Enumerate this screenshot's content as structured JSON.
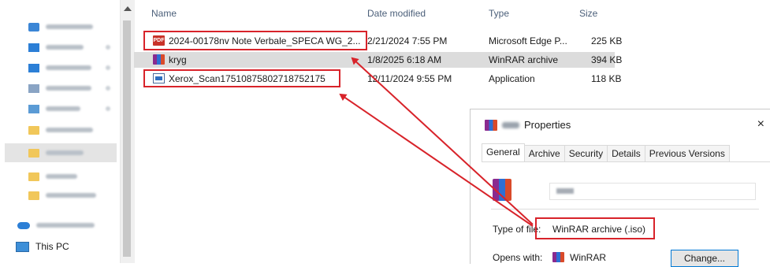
{
  "nav": {
    "this_pc": "This PC"
  },
  "columns": {
    "name": "Name",
    "date": "Date modified",
    "type": "Type",
    "size": "Size"
  },
  "files": [
    {
      "name": "2024-00178nv Note Verbale_SPECA WG_2...",
      "date": "2/21/2024 7:55 PM",
      "type": "Microsoft Edge P...",
      "size": "225 KB",
      "icon": "pdf-icon"
    },
    {
      "name": "kryg",
      "date": "1/8/2025 6:18 AM",
      "type": "WinRAR archive",
      "size": "394 KB",
      "icon": "winrar-icon"
    },
    {
      "name": "Xerox_Scan17510875802718752175",
      "date": "12/11/2024 9:55 PM",
      "type": "Application",
      "size": "118 KB",
      "icon": "application-icon"
    }
  ],
  "pdf_badge": "PDF",
  "dialog": {
    "title": "Properties",
    "close": "×",
    "tabs": [
      "General",
      "Archive",
      "Security",
      "Details",
      "Previous Versions"
    ],
    "type_label": "Type of file:",
    "type_value": "WinRAR archive (.iso)",
    "opens_label": "Opens with:",
    "opens_value": "WinRAR",
    "change_button": "Change..."
  },
  "colors": {
    "annotation_red": "#d8232a",
    "selection": "#dcdcdc",
    "header_text": "#4c607a"
  }
}
